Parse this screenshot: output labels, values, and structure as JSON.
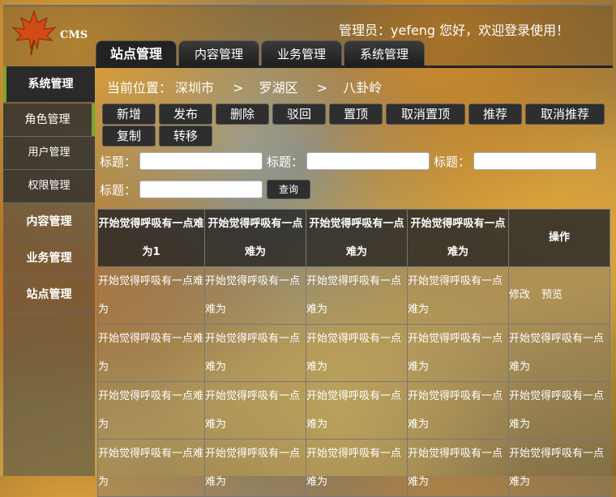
{
  "header": {
    "logo_text": "CMS",
    "welcome": "管理员：yefeng 您好，欢迎登录使用！"
  },
  "tabs": [
    {
      "label": "站点管理",
      "active": true
    },
    {
      "label": "内容管理"
    },
    {
      "label": "业务管理"
    },
    {
      "label": "系统管理"
    }
  ],
  "sidebar": {
    "items": [
      {
        "label": "系统管理"
      },
      {
        "label": "角色管理"
      },
      {
        "label": "用户管理"
      },
      {
        "label": "权限管理"
      },
      {
        "label": "内容管理"
      },
      {
        "label": "业务管理"
      },
      {
        "label": "站点管理"
      }
    ]
  },
  "breadcrumb": {
    "prefix": "当前位置：",
    "items": [
      "深圳市",
      "罗湖区",
      "八卦岭"
    ],
    "separator": ">"
  },
  "toolbar": {
    "buttons": [
      "新增",
      "发布",
      "删除",
      "驳回",
      "置顶",
      "取消置顶",
      "推荐",
      "取消推荐",
      "复制",
      "转移"
    ]
  },
  "filters": {
    "label": "标题：",
    "query_button": "查询"
  },
  "table": {
    "headers": [
      "开始觉得呼吸有一点难为1",
      "开始觉得呼吸有一点难为",
      "开始觉得呼吸有一点难为",
      "开始觉得呼吸有一点难为",
      "操作"
    ],
    "rows": [
      [
        "开始觉得呼吸有一点难为",
        "开始觉得呼吸有一点难为",
        "开始觉得呼吸有一点难为",
        "开始觉得呼吸有一点难为",
        {
          "actions": [
            "修改",
            "预览"
          ]
        }
      ],
      [
        "开始觉得呼吸有一点难为",
        "开始觉得呼吸有一点难为",
        "开始觉得呼吸有一点难为",
        "开始觉得呼吸有一点难为",
        "开始觉得呼吸有一点难为"
      ],
      [
        "开始觉得呼吸有一点难为",
        "开始觉得呼吸有一点难为",
        "开始觉得呼吸有一点难为",
        "开始觉得呼吸有一点难为",
        "开始觉得呼吸有一点难为"
      ],
      [
        "开始觉得呼吸有一点难为",
        "开始觉得呼吸有一点难为",
        "开始觉得呼吸有一点难为",
        "开始觉得呼吸有一点难为",
        "开始觉得呼吸有一点难为"
      ]
    ]
  },
  "colors": {
    "accent": "#7aa62e",
    "dark_panel": "#2a2a2a"
  }
}
